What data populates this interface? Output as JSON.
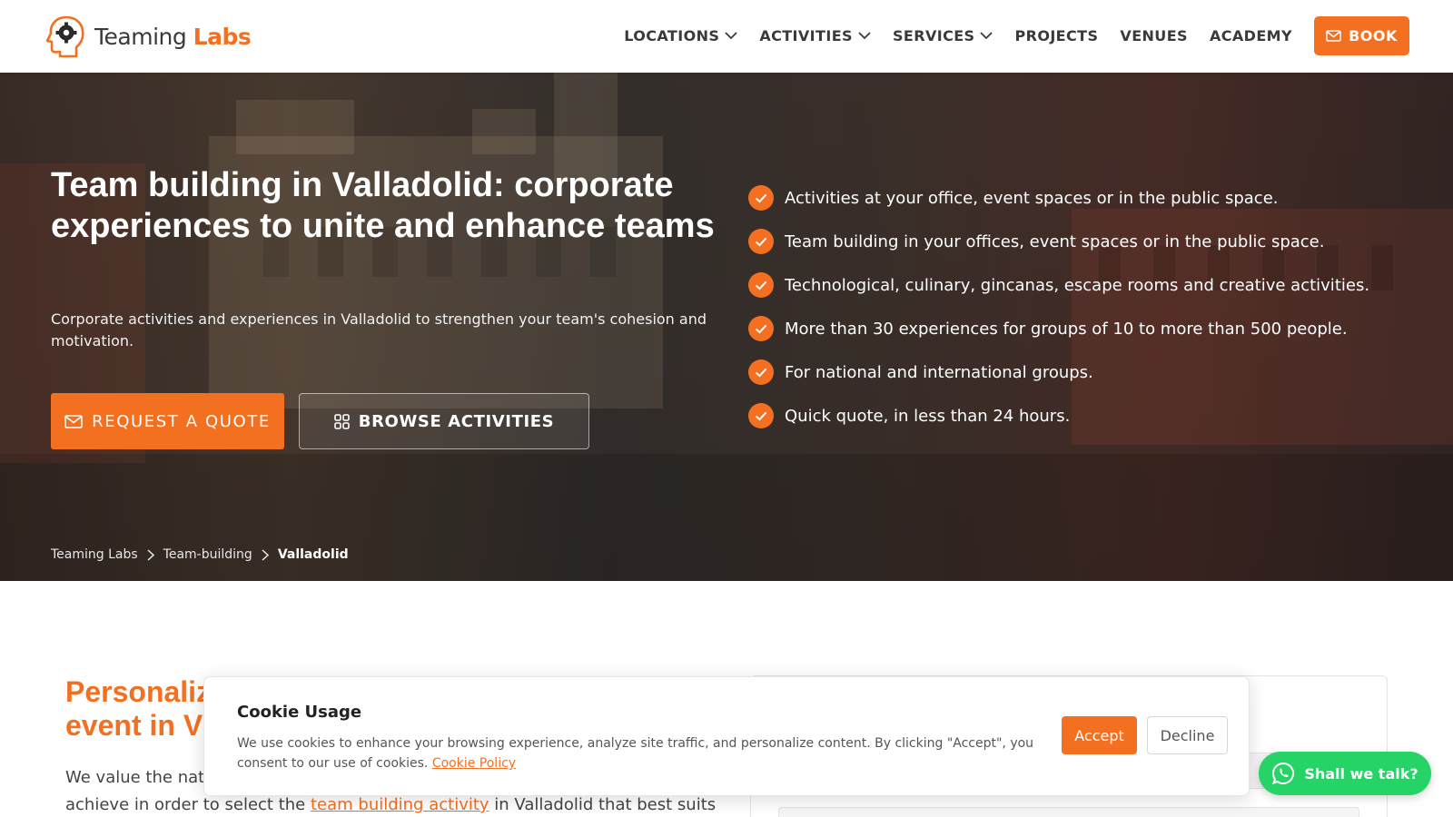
{
  "brand": {
    "name_part1": "Teaming",
    "name_part2": "Labs",
    "accent_color": "#f37021",
    "logo_icon": "head-gear-icon"
  },
  "nav": {
    "items": [
      {
        "label": "LOCATIONS",
        "dropdown": true
      },
      {
        "label": "ACTIVITIES",
        "dropdown": true
      },
      {
        "label": "SERVICES",
        "dropdown": true
      },
      {
        "label": "PROJECTS",
        "dropdown": false
      },
      {
        "label": "VENUES",
        "dropdown": false
      },
      {
        "label": "ACADEMY",
        "dropdown": false
      }
    ],
    "book_label": "BOOK"
  },
  "hero": {
    "title": "Team building in Valladolid: corporate experiences to unite and enhance teams",
    "subtitle": "Corporate activities and experiences in Valladolid to strengthen your team's cohesion and motivation.",
    "quote_button": "REQUEST A QUOTE",
    "browse_button": "BROWSE ACTIVITIES",
    "features": [
      "Activities at your office, event spaces or in the public space.",
      "Team building in your offices, event spaces or in the public space.",
      "Technological, culinary, gincanas, escape rooms and creative activities.",
      "More than 30 experiences for groups of 10 to more than 500 people.",
      "For national and international groups.",
      "Quick quote, in less than 24 hours."
    ]
  },
  "breadcrumb": {
    "items": [
      "Teaming Labs",
      "Team-building",
      "Valladolid"
    ]
  },
  "section": {
    "title_line1": "Personaliz",
    "title_line2": "event in V",
    "body_start": "We value the natu",
    "body_line2_pre": "achieve in order to select the ",
    "body_link": "team building activity",
    "body_line2_post": " in Valladolid that best suits"
  },
  "cookie": {
    "title": "Cookie Usage",
    "text": "We use cookies to enhance your browsing experience, analyze site traffic, and personalize content. By clicking \"Accept\", you consent to our use of cookies.",
    "policy_link": "Cookie Policy",
    "accept": "Accept",
    "decline": "Decline"
  },
  "chat": {
    "label": "Shall we talk?",
    "color": "#25d366",
    "icon": "whatsapp-icon"
  }
}
